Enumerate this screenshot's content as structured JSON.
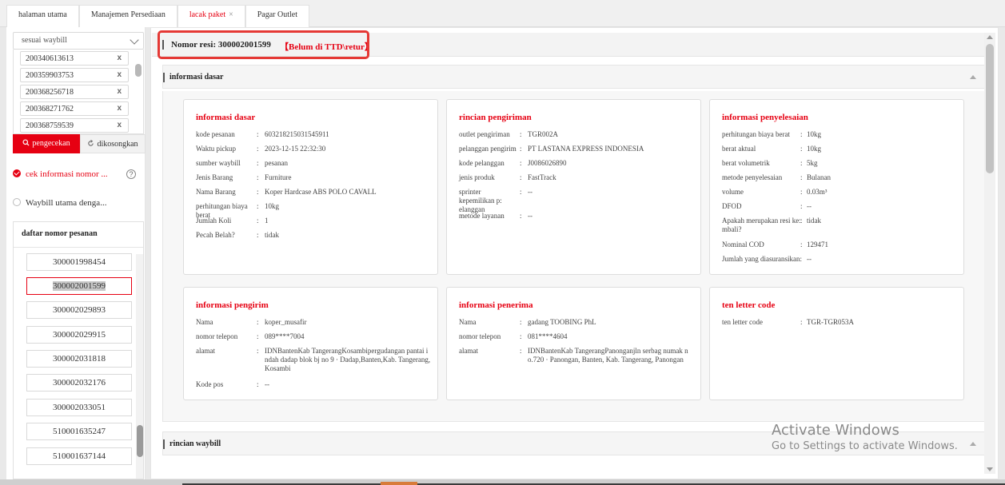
{
  "tabs": [
    {
      "label": "halaman utama",
      "active": false
    },
    {
      "label": "Manajemen Persediaan",
      "active": false
    },
    {
      "label": "lacak paket",
      "active": true,
      "close": "×"
    },
    {
      "label": "Pagar Outlet",
      "active": false
    }
  ],
  "left": {
    "select_value": "sesuai waybill",
    "waybills": [
      "200340613613",
      "200359903753",
      "200368256718",
      "200368271762",
      "200368759539"
    ],
    "remove_glyph": "x",
    "search_button": "pengecekan",
    "clear_button": "dikosongkan",
    "option_checked": "cek informasi nomor ...",
    "option_unchecked": "Waybill utama denga...",
    "help_glyph": "?",
    "order_list_title": "daftar nomor pesanan",
    "orders": [
      "300001998454",
      "300002001599",
      "300002029893",
      "300002029915",
      "300002031818",
      "300002032176",
      "300002033051",
      "510001635247",
      "510001637144"
    ],
    "selected_order_index": 1
  },
  "main": {
    "resi_label": "Nomor resi:  300002001599",
    "resi_status": "【Belum di TTD\\retur】",
    "section1_label": "informasi dasar",
    "section2_label": "rincian waybill",
    "cards": {
      "basic": {
        "title": "informasi dasar",
        "rows": [
          {
            "k": "kode pesanan",
            "v": "603218215031545911"
          },
          {
            "k": "Waktu pickup",
            "v": "2023-12-15 22:32:30"
          },
          {
            "k": "sumber waybill",
            "v": "pesanan"
          },
          {
            "k": "Jenis Barang",
            "v": "Furniture"
          },
          {
            "k": "Nama Barang",
            "v": "Koper Hardcase ABS POLO CAVALL"
          },
          {
            "k": "perhitungan biaya berat",
            "v": "10kg"
          },
          {
            "k": "Jumlah Koli",
            "v": "1"
          },
          {
            "k": "Pecah Belah?",
            "v": "tidak"
          }
        ]
      },
      "shipping": {
        "title": "rincian pengiriman",
        "rows": [
          {
            "k": "outlet pengiriman",
            "v": "TGR002A"
          },
          {
            "k": "pelanggan pengirim",
            "v": "PT LASTANA EXPRESS INDONESIA"
          },
          {
            "k": "kode pelanggan",
            "v": "J0086026890"
          },
          {
            "k": "jenis produk",
            "v": "FastTrack"
          },
          {
            "k": "sprinter kepemilikan p: elanggan",
            "v": "--"
          },
          {
            "k": "metode layanan",
            "v": "--"
          }
        ]
      },
      "settlement": {
        "title": "informasi penyelesaian",
        "rows": [
          {
            "k": "perhitungan biaya berat",
            "v": "10kg"
          },
          {
            "k": "berat aktual",
            "v": "10kg"
          },
          {
            "k": "berat volumetrik",
            "v": "5kg"
          },
          {
            "k": "metode penyelesaian",
            "v": "Bulanan"
          },
          {
            "k": "volume",
            "v": "0.03m³"
          },
          {
            "k": "DFOD",
            "v": "--"
          },
          {
            "k": "Apakah merupakan resi ke: mbali?",
            "v": "tidak"
          },
          {
            "k": "Nominal COD",
            "v": "129471"
          },
          {
            "k": "Jumlah yang diasuransikan:",
            "v": "--"
          }
        ]
      },
      "sender": {
        "title": "informasi pengirim",
        "rows": [
          {
            "k": "Nama",
            "v": "koper_musafir"
          },
          {
            "k": "nomor telepon",
            "v": "089****7004"
          },
          {
            "k": "alamat",
            "v": "IDNBantenKab TangerangKosambipergudangan pantai i ndah dadap blok bj no 9 · Dadap,Banten,Kab. Tangerang, Kosambi"
          },
          {
            "k": "Kode pos",
            "v": "--"
          }
        ]
      },
      "receiver": {
        "title": "informasi penerima",
        "rows": [
          {
            "k": "Nama",
            "v": "gadang TOOBING PhL"
          },
          {
            "k": "nomor telepon",
            "v": "081****4604"
          },
          {
            "k": "alamat",
            "v": "IDNBantenKab TangerangPanonganjln serbag numak n o.720 · Panongan, Banten, Kab. Tangerang, Panongan"
          }
        ]
      },
      "tenletter": {
        "title": "ten letter code",
        "rows": [
          {
            "k": "ten letter code",
            "v": "TGR-TGR053A"
          }
        ]
      }
    }
  },
  "windows_notice": {
    "line1": "Activate Windows",
    "line2": "Go to Settings to activate Windows."
  },
  "colors": {
    "accent": "#e60012",
    "highlight_box": "#e53935"
  }
}
